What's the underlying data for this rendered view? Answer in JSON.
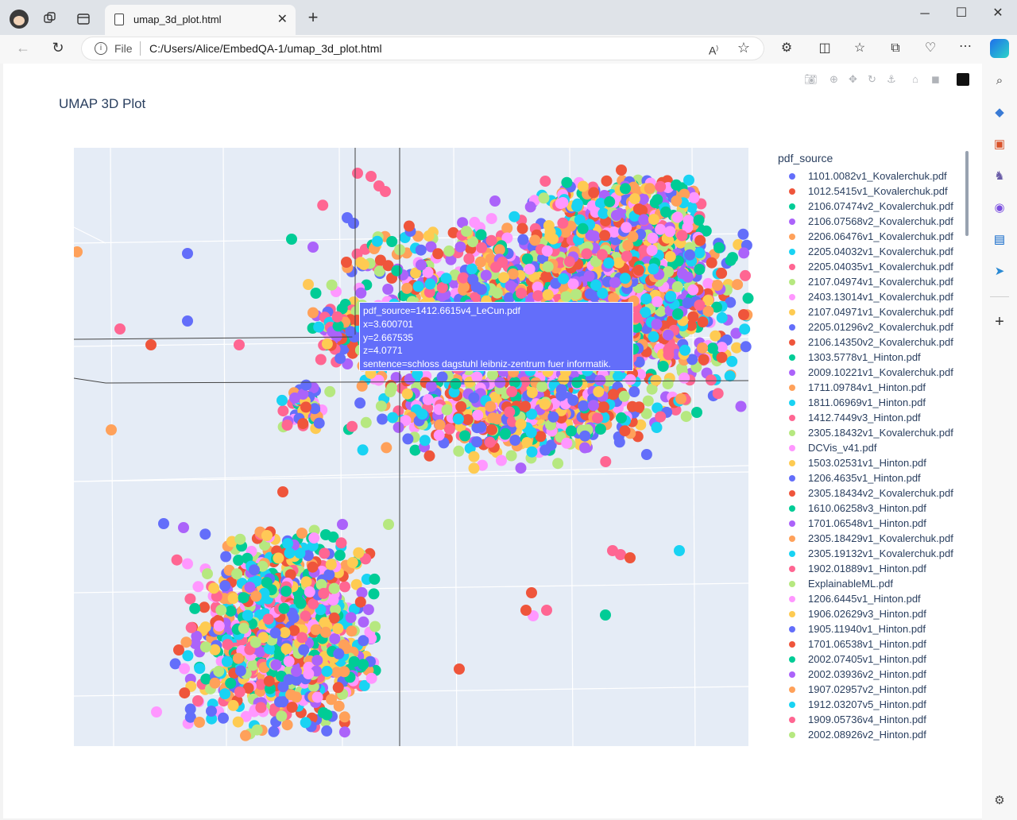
{
  "browser": {
    "tab_title": "umap_3d_plot.html",
    "tab_close": "✕",
    "new_tab": "+",
    "address_prefix": "File",
    "address_url": "C:/Users/Alice/EmbedQA-1/umap_3d_plot.html",
    "window_controls": [
      "─",
      "☐",
      "✕"
    ]
  },
  "plot": {
    "title": "UMAP 3D Plot",
    "legend_title": "pdf_source",
    "hover": {
      "lines": [
        "pdf_source=1412.6615v4_LeCun.pdf",
        "x=3.600701",
        "y=2.667535",
        "z=4.0771",
        "sentence=schloss dagstuhl leibniz-zentrum fuer informatik."
      ],
      "color": "#636efa"
    },
    "colors": [
      "#636efa",
      "#ef553b",
      "#00cc96",
      "#ab63fa",
      "#ffa15a",
      "#19d3f3",
      "#ff6692",
      "#b6e880",
      "#ff97ff",
      "#fecb52"
    ],
    "scene_bg": "#e5ecf6"
  },
  "chart_data": {
    "type": "scatter",
    "title": "UMAP 3D Plot",
    "legend_title": "pdf_source",
    "series": [
      {
        "name": "1101.0082v1_Kovalerchuk.pdf"
      },
      {
        "name": "1012.5415v1_Kovalerchuk.pdf"
      },
      {
        "name": "2106.07474v2_Kovalerchuk.pdf"
      },
      {
        "name": "2106.07568v2_Kovalerchuk.pdf"
      },
      {
        "name": "2206.06476v1_Kovalerchuk.pdf"
      },
      {
        "name": "2205.04032v1_Kovalerchuk.pdf"
      },
      {
        "name": "2205.04035v1_Kovalerchuk.pdf"
      },
      {
        "name": "2107.04974v1_Kovalerchuk.pdf"
      },
      {
        "name": "2403.13014v1_Kovalerchuk.pdf"
      },
      {
        "name": "2107.04971v1_Kovalerchuk.pdf"
      },
      {
        "name": "2205.01296v2_Kovalerchuk.pdf"
      },
      {
        "name": "2106.14350v2_Kovalerchuk.pdf"
      },
      {
        "name": "1303.5778v1_Hinton.pdf"
      },
      {
        "name": "2009.10221v1_Kovalerchuk.pdf"
      },
      {
        "name": "1711.09784v1_Hinton.pdf"
      },
      {
        "name": "1811.06969v1_Hinton.pdf"
      },
      {
        "name": "1412.7449v3_Hinton.pdf"
      },
      {
        "name": "2305.18432v1_Kovalerchuk.pdf"
      },
      {
        "name": "DCVis_v41.pdf"
      },
      {
        "name": "1503.02531v1_Hinton.pdf"
      },
      {
        "name": "1206.4635v1_Hinton.pdf"
      },
      {
        "name": "2305.18434v2_Kovalerchuk.pdf"
      },
      {
        "name": "1610.06258v3_Hinton.pdf"
      },
      {
        "name": "1701.06548v1_Hinton.pdf"
      },
      {
        "name": "2305.18429v1_Kovalerchuk.pdf"
      },
      {
        "name": "2305.19132v1_Kovalerchuk.pdf"
      },
      {
        "name": "1902.01889v1_Hinton.pdf"
      },
      {
        "name": "ExplainableML.pdf"
      },
      {
        "name": "1206.6445v1_Hinton.pdf"
      },
      {
        "name": "1906.02629v3_Hinton.pdf"
      },
      {
        "name": "1905.11940v1_Hinton.pdf"
      },
      {
        "name": "1701.06538v1_Hinton.pdf"
      },
      {
        "name": "2002.07405v1_Hinton.pdf"
      },
      {
        "name": "2002.03936v2_Hinton.pdf"
      },
      {
        "name": "1907.02957v2_Hinton.pdf"
      },
      {
        "name": "1912.03207v5_Hinton.pdf"
      },
      {
        "name": "1909.05736v4_Hinton.pdf"
      },
      {
        "name": "2002.08926v2_Hinton.pdf"
      }
    ]
  }
}
